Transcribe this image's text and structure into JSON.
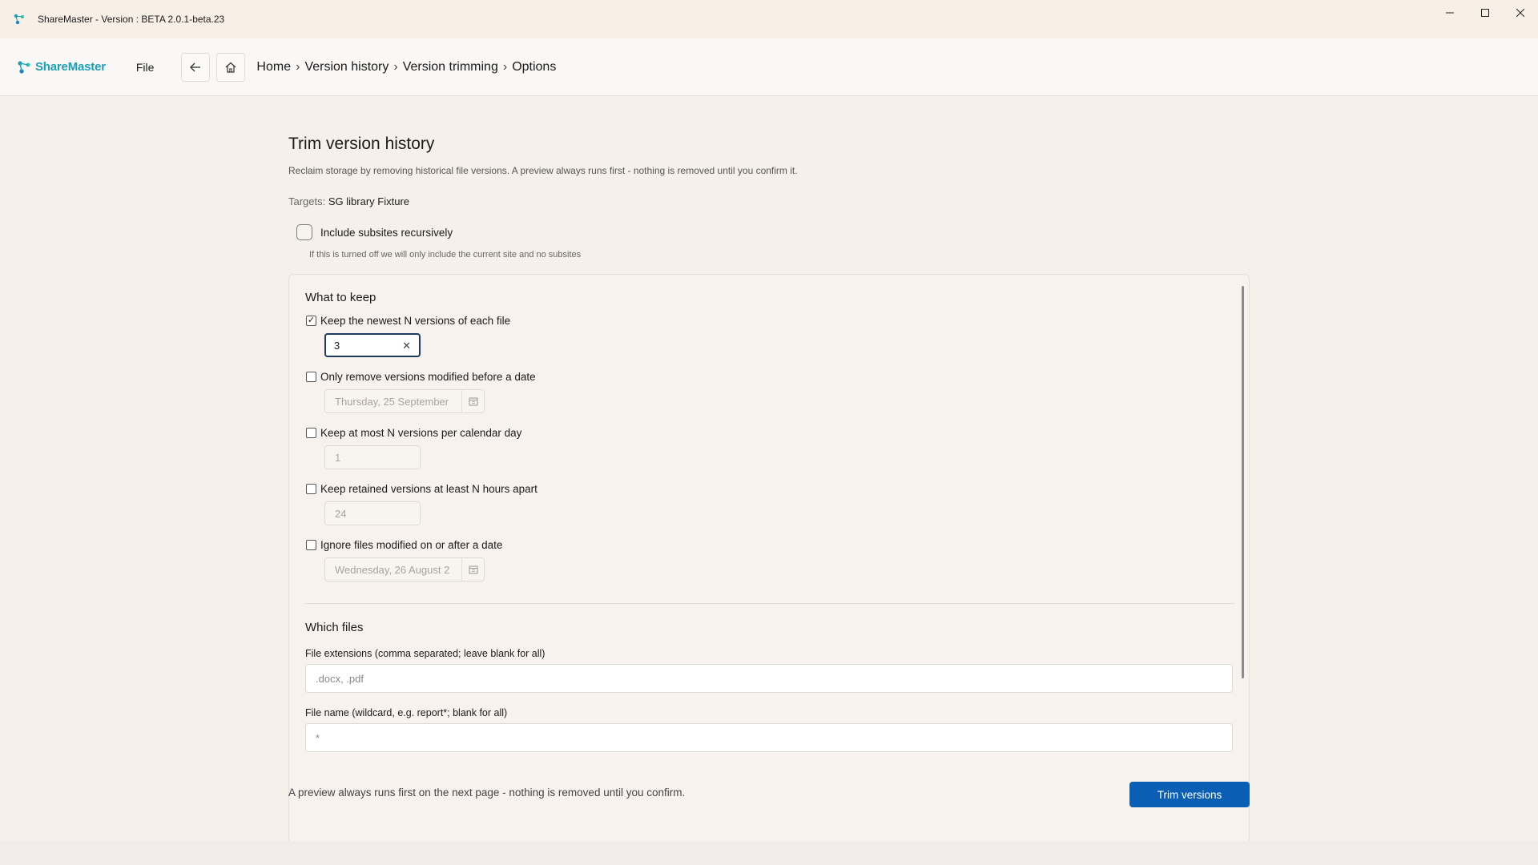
{
  "window": {
    "title": "ShareMaster - Version : BETA 2.0.1-beta.23",
    "controls": [
      "minimize-icon",
      "maximize-icon",
      "close-icon"
    ]
  },
  "navbar": {
    "brand": "ShareMaster",
    "menu_file": "File",
    "breadcrumb": [
      "Home",
      "Version history",
      "Version trimming",
      "Options"
    ],
    "separator": "›"
  },
  "page": {
    "title": "Trim version history",
    "description": "Reclaim storage by removing historical file versions. A preview always runs first - nothing is removed until you confirm it.",
    "targets_label": "Targets:",
    "targets_value": "SG library Fixture",
    "subsites_label": "Include subsites recursively",
    "subsites_checked": false,
    "subsites_help": "If this is turned off we will only include the current site and no subsites"
  },
  "keep": {
    "title": "What to keep",
    "options": [
      {
        "label": "Keep the newest N versions of each file",
        "checked": true,
        "value": "3",
        "type": "number"
      },
      {
        "label": "Only remove versions modified before a date",
        "checked": false,
        "value": "Thursday, 25 September",
        "type": "date"
      },
      {
        "label": "Keep at most N versions per calendar day",
        "checked": false,
        "value": "1",
        "type": "number"
      },
      {
        "label": "Keep retained versions at least N hours apart",
        "checked": false,
        "value": "24",
        "type": "number"
      },
      {
        "label": "Ignore files modified on or after a date",
        "checked": false,
        "value": "Wednesday, 26 August 2",
        "type": "date"
      }
    ]
  },
  "files": {
    "title": "Which files",
    "extensions_label": "File extensions (comma separated; leave blank for all)",
    "extensions_placeholder": ".docx, .pdf",
    "name_label": "File name (wildcard, e.g. report*; blank for all)",
    "name_value": "*"
  },
  "footer": {
    "note": "A preview always runs first on the next page - nothing is removed until you confirm.",
    "trim_button": "Trim versions"
  },
  "colors": {
    "accent": "#0a5fb4",
    "brand": "#1aa0b8",
    "background": "#f6f0ea"
  }
}
